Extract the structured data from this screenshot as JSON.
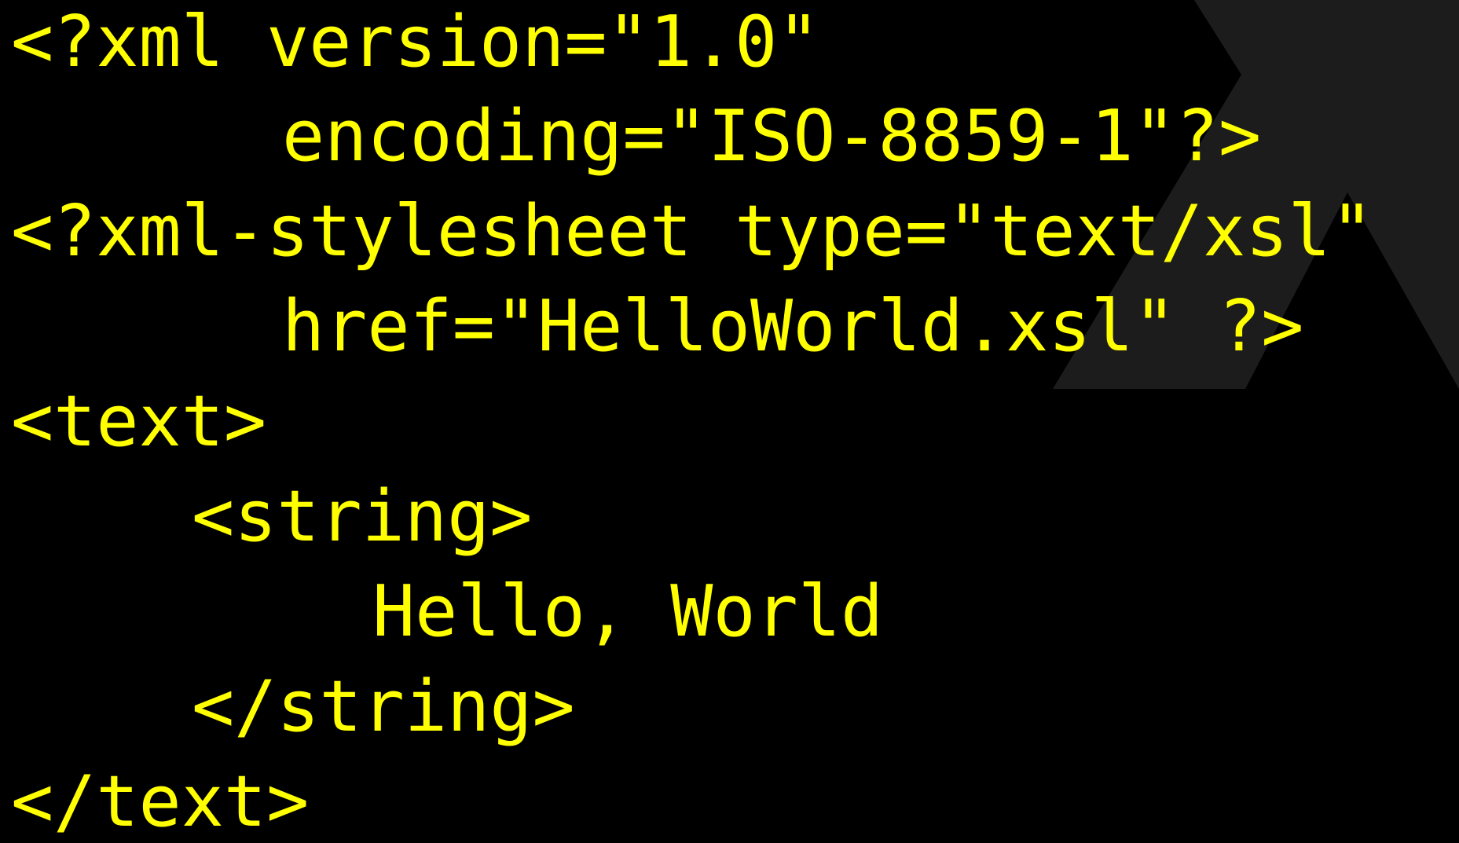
{
  "colors": {
    "background": "#000000",
    "text": "#ffff00",
    "decoration": "#1c1c1c"
  },
  "code_lines": [
    "<?xml version=\"1.0\"",
    "encoding=\"ISO-8859-1\"?>",
    "<?xml-stylesheet type=\"text/xsl\"",
    "href=\"HelloWorld.xsl\" ?>",
    "<text>",
    "<string>",
    "Hello, World",
    "</string>",
    "</text>"
  ]
}
